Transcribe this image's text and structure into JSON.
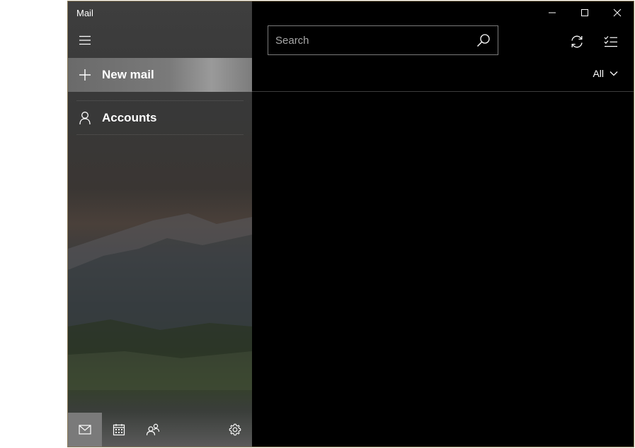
{
  "app": {
    "title": "Mail"
  },
  "sidebar": {
    "new_mail_label": "New mail",
    "accounts_label": "Accounts"
  },
  "search": {
    "placeholder": "Search"
  },
  "filter": {
    "label": "All"
  },
  "colors": {
    "window_border": "#8a7a58",
    "main_background": "#000000",
    "selected_nav_background": "#7a7a7a"
  },
  "icons": {
    "hamburger": "hamburger-icon",
    "new_mail": "plus-icon",
    "accounts": "person-icon",
    "search": "search-icon",
    "sync": "sync-icon",
    "select": "select-mode-icon",
    "filter": "chevron-down-icon",
    "mail": "mail-icon",
    "calendar": "calendar-icon",
    "people": "people-icon",
    "settings": "gear-icon"
  }
}
